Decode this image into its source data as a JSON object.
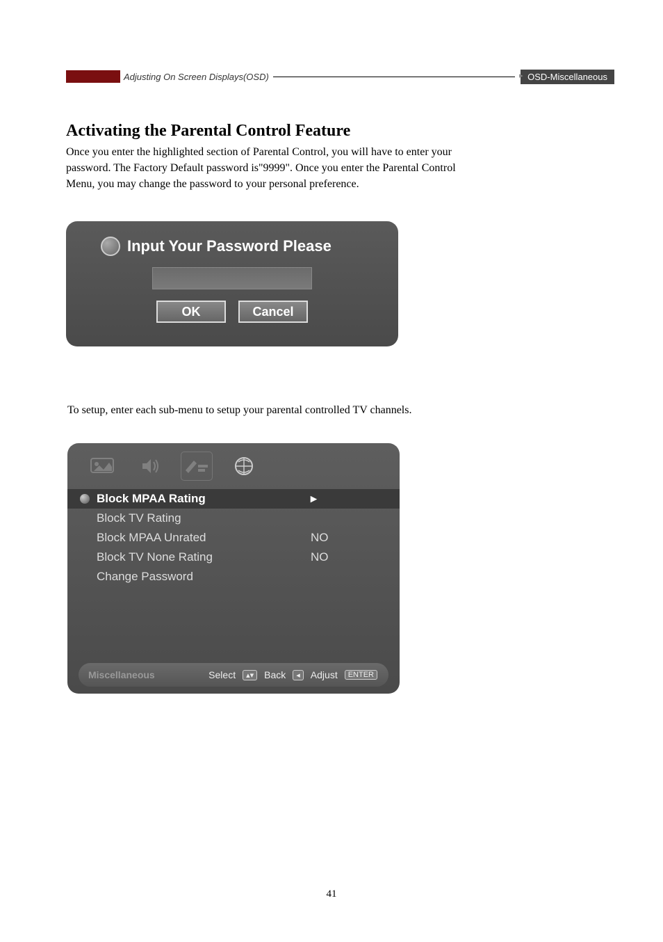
{
  "breadcrumb": {
    "left": "Adjusting On Screen Displays(OSD)",
    "right": "OSD-Miscellaneous"
  },
  "heading": "Activating the Parental Control Feature",
  "intro_text": "Once you enter the highlighted section of Parental Control, you will have to enter your password. The Factory Default password is\"9999\". Once you enter the Parental Control Menu, you may change the password to your personal preference.",
  "dialog": {
    "title": "Input Your Password Please",
    "ok_label": "OK",
    "cancel_label": "Cancel"
  },
  "setup_text": "To setup, enter each sub-menu to setup your parental controlled TV channels.",
  "menu": {
    "items": [
      {
        "label": "Block MPAA Rating",
        "value": "▸",
        "highlight": true
      },
      {
        "label": "Block TV Rating",
        "value": ""
      },
      {
        "label": "Block MPAA Unrated",
        "value": "NO"
      },
      {
        "label": "Block TV None Rating",
        "value": "NO"
      },
      {
        "label": "Change Password",
        "value": ""
      }
    ],
    "footer": {
      "section": "Miscellaneous",
      "select_label": "Select",
      "select_key": "▴▾",
      "back_label": "Back",
      "back_key": "◂",
      "adjust_label": "Adjust",
      "adjust_key": "ENTER"
    }
  },
  "page_number": "41"
}
